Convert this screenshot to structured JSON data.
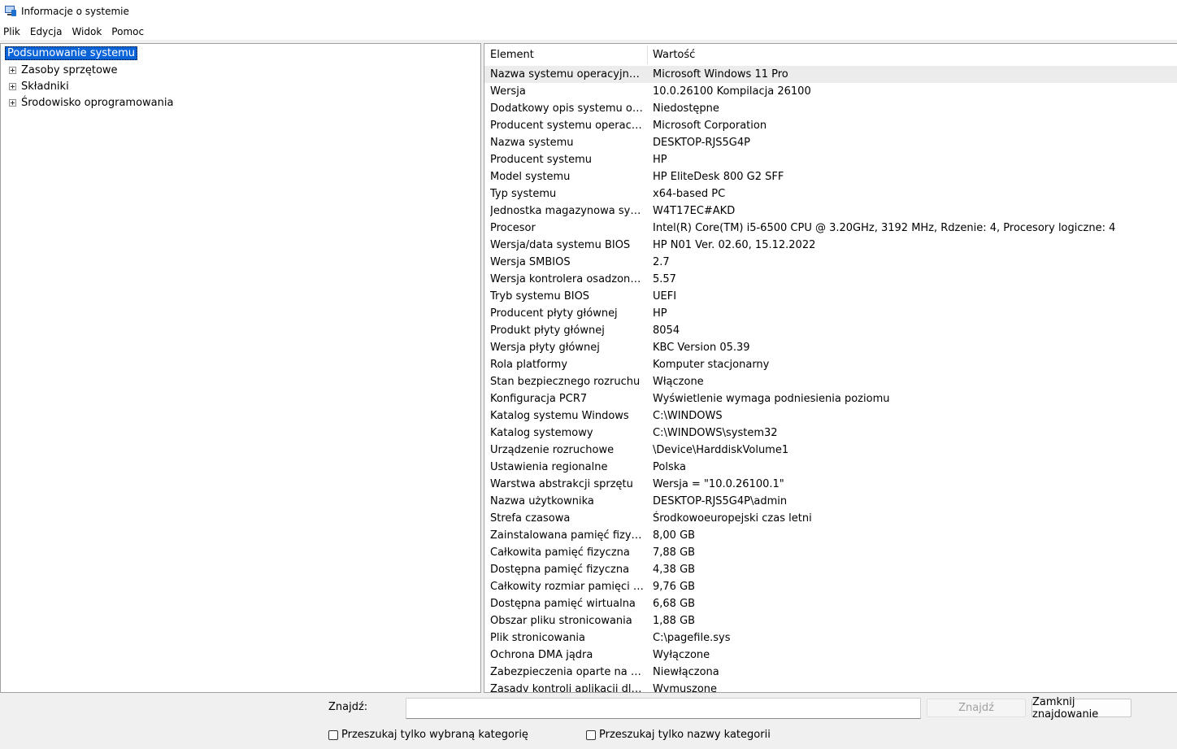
{
  "window": {
    "title": "Informacje o systemie",
    "icon": "system-info-icon"
  },
  "menu": [
    "Plik",
    "Edycja",
    "Widok",
    "Pomoc"
  ],
  "tree": {
    "selected": "Podsumowanie systemu",
    "items": [
      "Zasoby sprzętowe",
      "Składniki",
      "Środowisko oprogramowania"
    ]
  },
  "list": {
    "headers": [
      "Element",
      "Wartość"
    ],
    "rows": [
      [
        "Nazwa systemu operacyjnego",
        "Microsoft Windows 11 Pro"
      ],
      [
        "Wersja",
        "10.0.26100 Kompilacja 26100"
      ],
      [
        "Dodatkowy opis systemu oper...",
        "Niedostępne"
      ],
      [
        "Producent systemu operacyjne...",
        "Microsoft Corporation"
      ],
      [
        "Nazwa systemu",
        "DESKTOP-RJS5G4P"
      ],
      [
        "Producent systemu",
        "HP"
      ],
      [
        "Model systemu",
        "HP EliteDesk 800 G2 SFF"
      ],
      [
        "Typ systemu",
        "x64-based PC"
      ],
      [
        "Jednostka magazynowa systemu",
        "W4T17EC#AKD"
      ],
      [
        "Procesor",
        "Intel(R) Core(TM) i5-6500 CPU @ 3.20GHz, 3192 MHz, Rdzenie: 4, Procesory logiczne: 4"
      ],
      [
        "Wersja/data systemu BIOS",
        "HP N01 Ver. 02.60, 15.12.2022"
      ],
      [
        "Wersja SMBIOS",
        "2.7"
      ],
      [
        "Wersja kontrolera osadzonego",
        "5.57"
      ],
      [
        "Tryb systemu BIOS",
        "UEFI"
      ],
      [
        "Producent płyty głównej",
        "HP"
      ],
      [
        "Produkt płyty głównej",
        "8054"
      ],
      [
        "Wersja płyty głównej",
        "KBC Version 05.39"
      ],
      [
        "Rola platformy",
        "Komputer stacjonarny"
      ],
      [
        "Stan bezpiecznego rozruchu",
        "Włączone"
      ],
      [
        "Konfiguracja PCR7",
        "Wyświetlenie wymaga podniesienia poziomu"
      ],
      [
        "Katalog systemu Windows",
        "C:\\WINDOWS"
      ],
      [
        "Katalog systemowy",
        "C:\\WINDOWS\\system32"
      ],
      [
        "Urządzenie rozruchowe",
        "\\Device\\HarddiskVolume1"
      ],
      [
        "Ustawienia regionalne",
        "Polska"
      ],
      [
        "Warstwa abstrakcji sprzętu",
        "Wersja = \"10.0.26100.1\""
      ],
      [
        "Nazwa użytkownika",
        "DESKTOP-RJS5G4P\\admin"
      ],
      [
        "Strefa czasowa",
        "Środkowoeuropejski czas letni"
      ],
      [
        "Zainstalowana pamięć fizyczna ...",
        "8,00 GB"
      ],
      [
        "Całkowita pamięć fizyczna",
        "7,88 GB"
      ],
      [
        "Dostępna pamięć fizyczna",
        "4,38 GB"
      ],
      [
        "Całkowity rozmiar pamięci wirt...",
        "9,76 GB"
      ],
      [
        "Dostępna pamięć wirtualna",
        "6,68 GB"
      ],
      [
        "Obszar pliku stronicowania",
        "1,88 GB"
      ],
      [
        "Plik stronicowania",
        "C:\\pagefile.sys"
      ],
      [
        "Ochrona DMA jądra",
        "Wyłączone"
      ],
      [
        "Zabezpieczenia oparte na wirtu...",
        "Niewłączona"
      ],
      [
        "Zasady kontroli aplikacji dla firm",
        "Wymuszone"
      ]
    ]
  },
  "find": {
    "label": "Znajdź:",
    "value": "",
    "find_button": "Znajdź",
    "close_button": "Zamknij znajdowanie",
    "checkbox_selected_category": "Przeszukaj tylko wybraną kategorię",
    "checkbox_category_names": "Przeszukaj tylko nazwy kategorii"
  },
  "colors": {
    "selection": "#0a64d8",
    "row_highlight": "#ececec"
  }
}
